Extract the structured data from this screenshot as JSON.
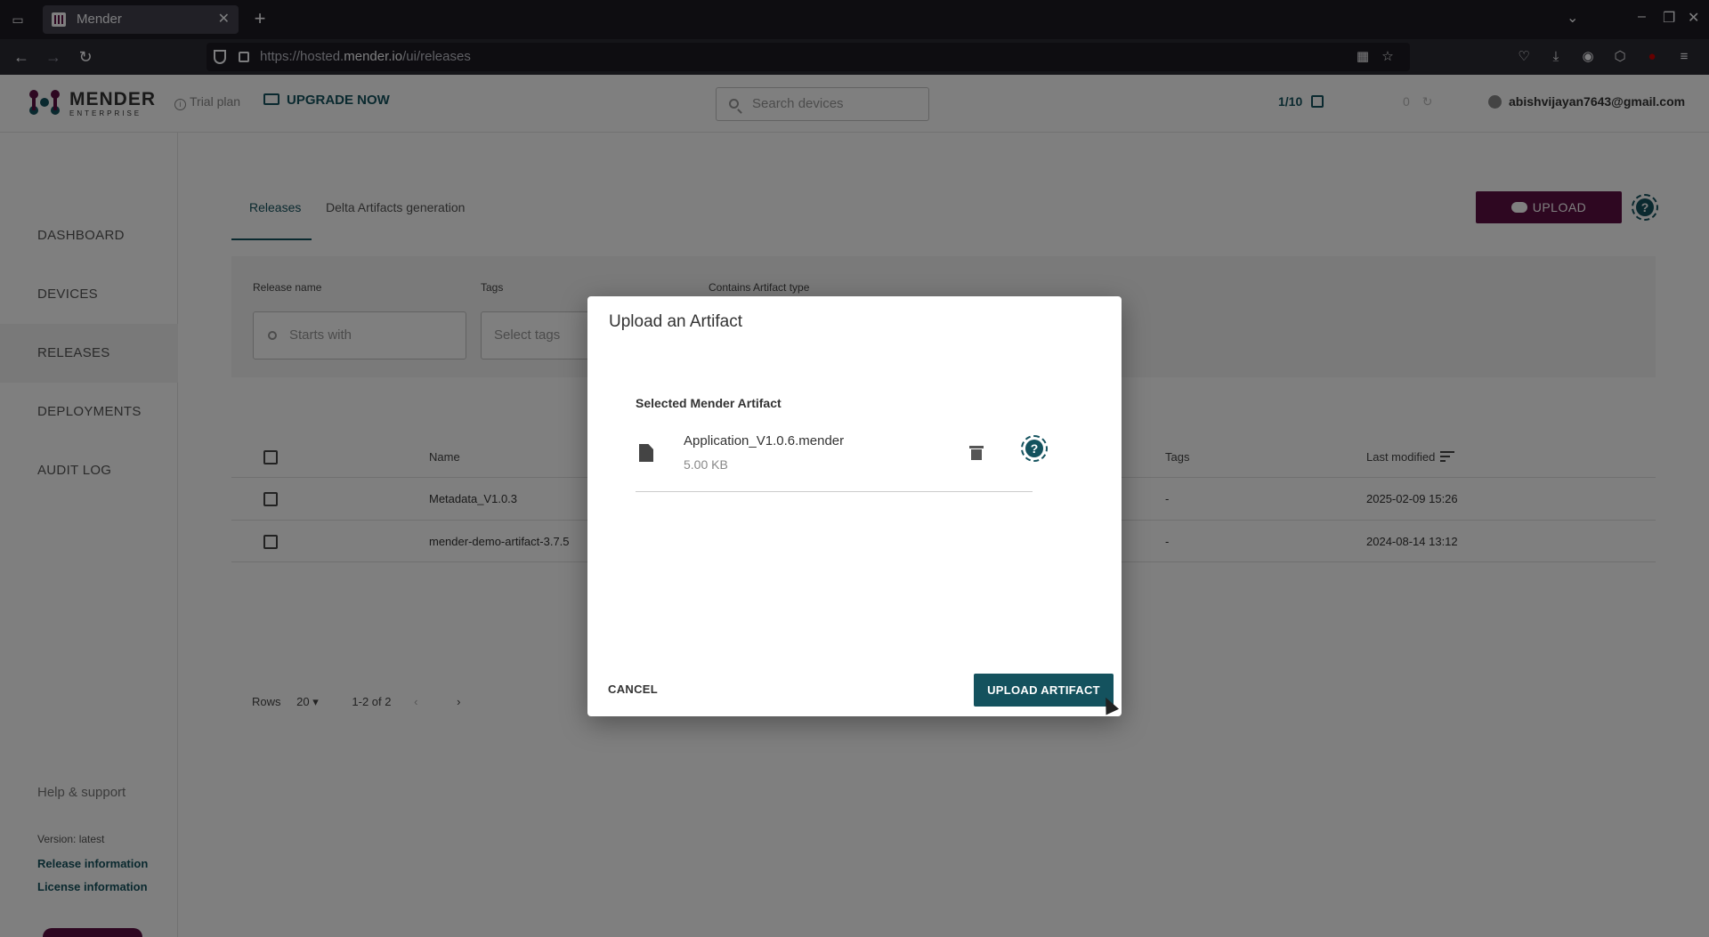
{
  "browser": {
    "tab_title": "Mender",
    "url_prefix": "https://hosted.",
    "url_domain": "mender.io",
    "url_path": "/ui/releases"
  },
  "header": {
    "logo_text": "MENDER",
    "logo_sub": "ENTERPRISE",
    "trial_label": "Trial plan",
    "upgrade_label": "UPGRADE NOW",
    "search_placeholder": "Search devices",
    "device_count": "1/10",
    "pending_count": "0",
    "user_email": "abishvijayan7643@gmail.com"
  },
  "sidebar": {
    "items": [
      {
        "label": "DASHBOARD"
      },
      {
        "label": "DEVICES"
      },
      {
        "label": "RELEASES"
      },
      {
        "label": "DEPLOYMENTS"
      },
      {
        "label": "AUDIT LOG"
      }
    ],
    "help": "Help & support",
    "version": "Version: latest",
    "release_info": "Release information",
    "license_info": "License information"
  },
  "main": {
    "tabs": [
      {
        "label": "Releases"
      },
      {
        "label": "Delta Artifacts generation"
      }
    ],
    "upload_label": "UPLOAD",
    "filters": {
      "release_name_label": "Release name",
      "release_name_placeholder": "Starts with",
      "tags_label": "Tags",
      "tags_placeholder": "Select tags",
      "artifact_type_label": "Contains Artifact type"
    },
    "table": {
      "col_name": "Name",
      "col_tags": "Tags",
      "col_modified": "Last modified",
      "rows": [
        {
          "name": "Metadata_V1.0.3",
          "tags": "-",
          "modified": "2025-02-09 15:26"
        },
        {
          "name": "mender-demo-artifact-3.7.5",
          "tags": "-",
          "modified": "2024-08-14 13:12"
        }
      ]
    },
    "pager": {
      "rows_label": "Rows",
      "rows_value": "20",
      "range": "1-2 of 2"
    }
  },
  "dialog": {
    "title": "Upload an Artifact",
    "subtitle": "Selected Mender Artifact",
    "file_name": "Application_V1.0.6.mender",
    "file_size": "5.00 KB",
    "cancel_label": "CANCEL",
    "upload_label": "UPLOAD ARTIFACT"
  },
  "colors": {
    "primary": "#14525e",
    "secondary": "#5d0f43"
  }
}
